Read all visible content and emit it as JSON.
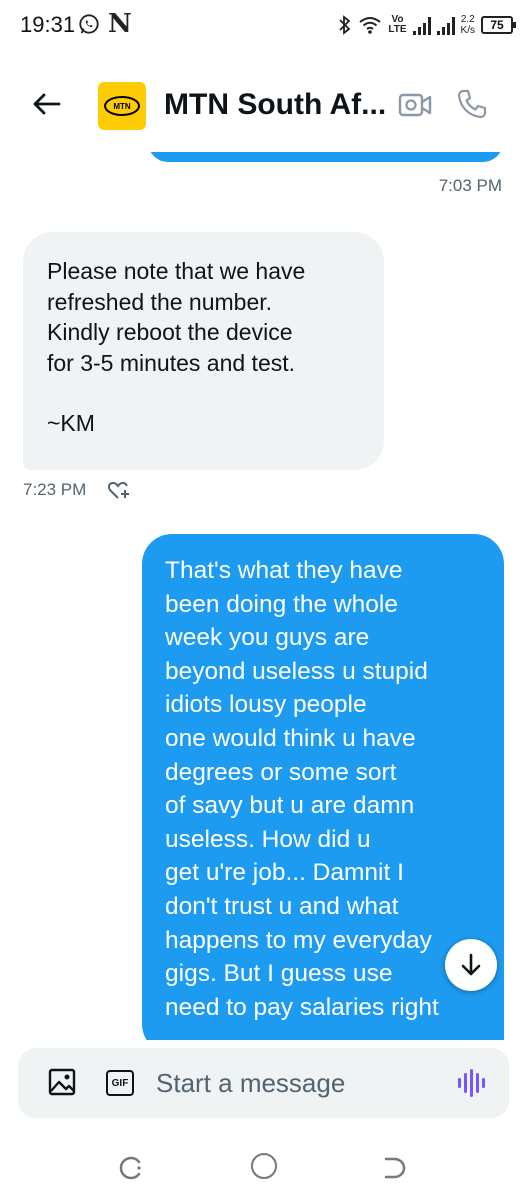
{
  "status_bar": {
    "time": "19:31",
    "volte_top": "Vo",
    "volte_bottom": "LTE",
    "net_speed_value": "2.2",
    "net_speed_unit": "K/s",
    "battery": "75"
  },
  "header": {
    "title": "MTN South Af...",
    "avatar_logo": "MTN"
  },
  "messages": [
    {
      "direction": "outgoing",
      "time": "7:03 PM"
    },
    {
      "direction": "incoming",
      "lines": [
        "Please note that we have",
        "refreshed the number.",
        "Kindly reboot the device",
        "for 3-5 minutes and test."
      ],
      "signature": "~KM",
      "time": "7:23 PM"
    },
    {
      "direction": "outgoing",
      "lines": [
        "That's what they have",
        "been doing the whole",
        "week you guys are",
        "beyond useless u stupid",
        "idiots lousy people",
        "one would think u have",
        "degrees or some sort",
        "of savy but u are damn",
        "useless. How did u",
        "get u're job... Damnit I",
        "don't trust u and what",
        "happens to my everyday",
        "gigs. But I guess use",
        "need to pay salaries right"
      ]
    }
  ],
  "composer": {
    "placeholder": "Start a message",
    "gif_label": "GIF"
  },
  "colors": {
    "outgoing_bubble": "#1d9bf0",
    "incoming_bubble": "#eff3f4",
    "brand_yellow": "#ffcb05",
    "voice_accent": "#7856ff",
    "secondary_text": "#536471"
  },
  "icons": [
    "whatsapp-icon",
    "n-notification-icon",
    "bluetooth-icon",
    "wifi-icon",
    "signal-icon",
    "battery-icon",
    "back-arrow-icon",
    "video-camera-icon",
    "phone-icon",
    "add-reaction-icon",
    "arrow-down-icon",
    "image-icon",
    "gif-icon",
    "voice-wave-icon",
    "recents-icon",
    "home-icon",
    "nav-back-icon"
  ]
}
